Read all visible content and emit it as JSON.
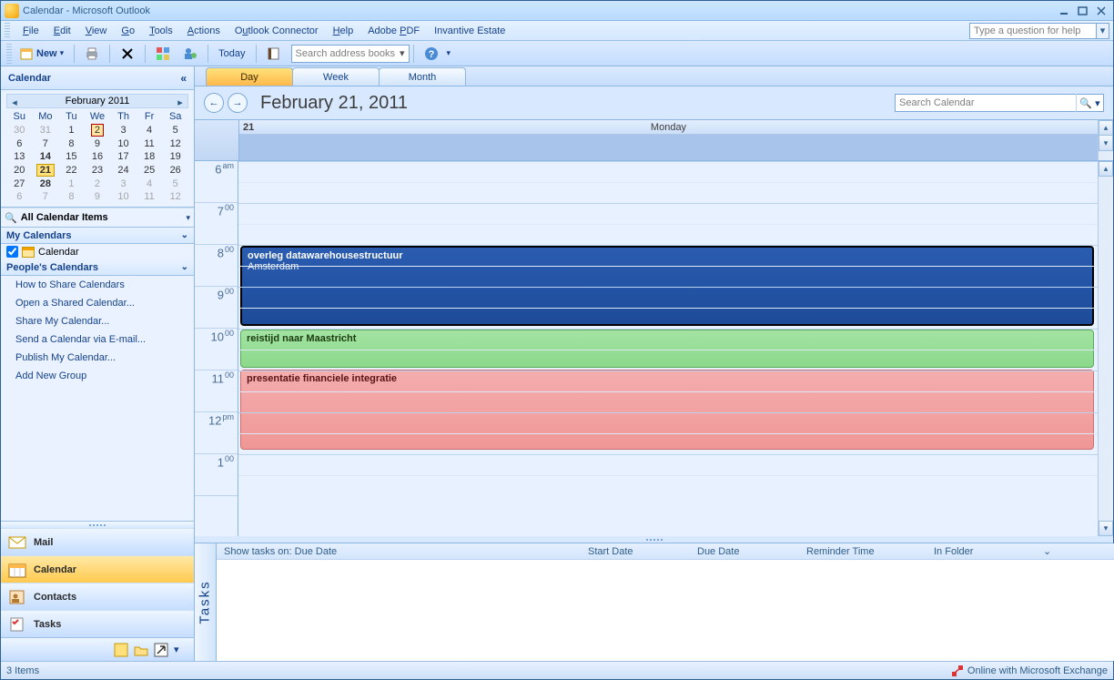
{
  "window": {
    "title": "Calendar - Microsoft Outlook"
  },
  "menus": {
    "file": "File",
    "edit": "Edit",
    "view": "View",
    "go": "Go",
    "tools": "Tools",
    "actions": "Actions",
    "connector": "Outlook Connector",
    "help": "Help",
    "adobe": "Adobe PDF",
    "invantive": "Invantive Estate"
  },
  "help_box_placeholder": "Type a question for help",
  "toolbar": {
    "new_label": "New",
    "today_label": "Today",
    "search_placeholder": "Search address books"
  },
  "nav": {
    "header": "Calendar",
    "month_label": "February 2011",
    "dow": [
      "Su",
      "Mo",
      "Tu",
      "We",
      "Th",
      "Fr",
      "Sa"
    ],
    "weeks": [
      [
        {
          "d": "30",
          "dim": true
        },
        {
          "d": "31",
          "dim": true
        },
        {
          "d": "1"
        },
        {
          "d": "2",
          "today": true
        },
        {
          "d": "3"
        },
        {
          "d": "4"
        },
        {
          "d": "5"
        }
      ],
      [
        {
          "d": "6"
        },
        {
          "d": "7"
        },
        {
          "d": "8"
        },
        {
          "d": "9"
        },
        {
          "d": "10"
        },
        {
          "d": "11"
        },
        {
          "d": "12"
        }
      ],
      [
        {
          "d": "13"
        },
        {
          "d": "14",
          "bold": true
        },
        {
          "d": "15"
        },
        {
          "d": "16"
        },
        {
          "d": "17"
        },
        {
          "d": "18"
        },
        {
          "d": "19"
        }
      ],
      [
        {
          "d": "20"
        },
        {
          "d": "21",
          "sel": true,
          "bold": true
        },
        {
          "d": "22"
        },
        {
          "d": "23"
        },
        {
          "d": "24"
        },
        {
          "d": "25"
        },
        {
          "d": "26"
        }
      ],
      [
        {
          "d": "27"
        },
        {
          "d": "28",
          "bold": true
        },
        {
          "d": "1",
          "dim": true
        },
        {
          "d": "2",
          "dim": true
        },
        {
          "d": "3",
          "dim": true
        },
        {
          "d": "4",
          "dim": true
        },
        {
          "d": "5",
          "dim": true
        }
      ],
      [
        {
          "d": "6",
          "dim": true
        },
        {
          "d": "7",
          "dim": true
        },
        {
          "d": "8",
          "dim": true
        },
        {
          "d": "9",
          "dim": true
        },
        {
          "d": "10",
          "dim": true
        },
        {
          "d": "11",
          "dim": true
        },
        {
          "d": "12",
          "dim": true
        }
      ]
    ],
    "all_cal_items": "All Calendar Items",
    "my_calendars": "My Calendars",
    "cal_name": "Calendar",
    "peoples_calendars": "People's Calendars",
    "links": {
      "share": "How to Share Calendars",
      "open": "Open a Shared Calendar...",
      "sharemy": "Share My Calendar...",
      "sendemail": "Send a Calendar via E-mail...",
      "publish": "Publish My Calendar...",
      "addgroup": "Add New Group"
    },
    "big": {
      "mail": "Mail",
      "calendar": "Calendar",
      "contacts": "Contacts",
      "tasks": "Tasks"
    }
  },
  "view_tabs": {
    "day": "Day",
    "week": "Week",
    "month": "Month"
  },
  "date_header": "February 21, 2011",
  "cal_search_placeholder": "Search Calendar",
  "day_header": {
    "num": "21",
    "name": "Monday"
  },
  "hours": [
    "6 am",
    "7 00",
    "8 00",
    "9 00",
    "10 00",
    "11 00",
    "12 pm",
    "1 00"
  ],
  "appointments": {
    "a1_title": "overleg datawarehousestructuur",
    "a1_loc": "Amsterdam",
    "a2_title": "reistijd naar Maastricht",
    "a3_title": "presentatie financiele integratie"
  },
  "tasks": {
    "label": "Tasks",
    "show_on": "Show tasks on: Due Date",
    "cols": {
      "start": "Start Date",
      "due": "Due Date",
      "reminder": "Reminder Time",
      "folder": "In Folder"
    }
  },
  "status": {
    "items": "3 Items",
    "online": "Online with Microsoft Exchange"
  }
}
